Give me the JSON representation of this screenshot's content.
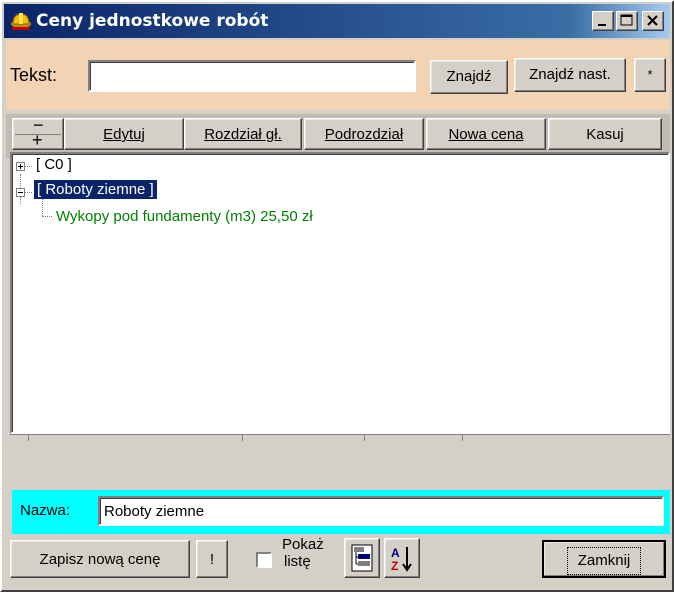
{
  "window": {
    "title": "Ceny jednostkowe robót",
    "controls": {
      "minimize": "_",
      "maximize": "□",
      "close": "×"
    }
  },
  "search": {
    "label": "Tekst:",
    "value": "",
    "find": "Znajdź",
    "find_next": "Znajdź nast.",
    "clear": "*"
  },
  "toolbar": {
    "collapse_expand": [
      "−",
      "+"
    ],
    "edit": "Edytuj",
    "main_section": "Rozdział gł.",
    "subsection": "Podrozdział",
    "new_price": "Nowa cena",
    "delete": "Kasuj"
  },
  "tree": {
    "nodes": [
      {
        "label": "[ C0 ]",
        "expanded": false,
        "selected": false
      },
      {
        "label": "[ Roboty ziemne ]",
        "expanded": true,
        "selected": true,
        "children": [
          {
            "label": "Wykopy pod fundamenty  (m3)  25,50 zł",
            "color": "#008000"
          }
        ]
      }
    ]
  },
  "name": {
    "label": "Nazwa:",
    "value": "Roboty ziemne"
  },
  "bottom": {
    "save_new_price": "Zapisz nową cenę",
    "exclaim": "!",
    "show_list": [
      "Pokaż",
      "listę"
    ],
    "show_list_checked": false,
    "close": "Zamknij"
  },
  "colors": {
    "title_gradient_start": "#0a246a",
    "search_panel": "#f2d4b5",
    "name_panel": "#00ffff",
    "selected_item": "#0a246a",
    "leaf_text": "#008000"
  },
  "icons": [
    "app-hardhat-icon",
    "tree-view-icon",
    "sort-az-icon"
  ]
}
